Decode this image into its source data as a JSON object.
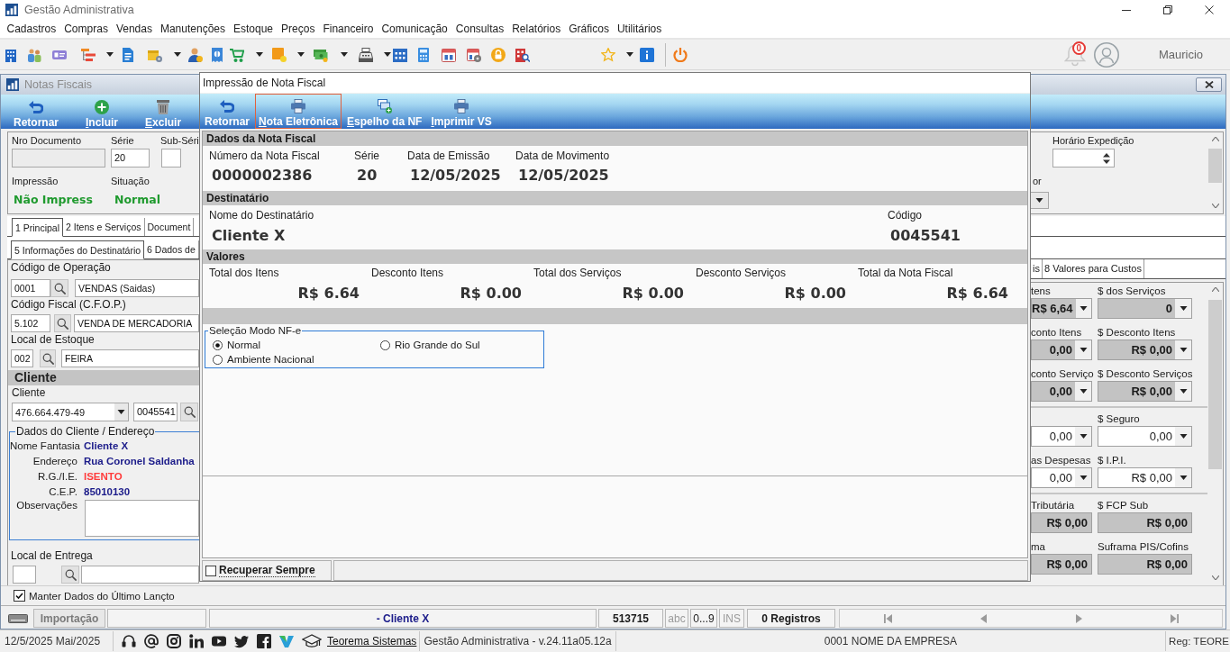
{
  "window": {
    "title": "Gestão Administrativa"
  },
  "menu": [
    "Cadastros",
    "Compras",
    "Vendas",
    "Manutenções",
    "Estoque",
    "Preços",
    "Financeiro",
    "Comunicação",
    "Consultas",
    "Relatórios",
    "Gráficos",
    "Utilitários"
  ],
  "user": {
    "notifications": "0",
    "name": "Mauricio"
  },
  "notas_fiscais": {
    "title": "Notas Fiscais",
    "toolbar": [
      {
        "label": "Retornar",
        "mnemonic": false
      },
      {
        "label": "Incluir",
        "mnemonic": true
      },
      {
        "label": "Excluir",
        "mnemonic": true
      }
    ],
    "header": {
      "nro_documento": {
        "label": "Nro Documento"
      },
      "serie": {
        "label": "Série",
        "value": "20"
      },
      "sub_serie": {
        "label": "Sub-Séri"
      },
      "impressao": {
        "label": "Impressão",
        "value": "Não Impress"
      },
      "situacao": {
        "label": "Situação",
        "value": "Normal"
      },
      "horario_expedicao": {
        "label": "Horário Expedição"
      },
      "field_7": {
        "label": "or"
      }
    },
    "tabs": [
      {
        "label": "1 Principal",
        "selected": true
      },
      {
        "label": "2 Itens e Serviços",
        "selected": false
      },
      {
        "label": "Document",
        "selected": false
      }
    ],
    "subtabs": [
      {
        "label": "5 Informações do Destinatário",
        "selected": true
      },
      {
        "label": "6 Dados de",
        "selected": false
      }
    ],
    "form": {
      "codigo_operacao": {
        "label": "Código de Operação",
        "code": "0001",
        "description": "VENDAS (Saidas)"
      },
      "codigo_fiscal": {
        "label": "Código Fiscal (C.F.O.P.)",
        "code": "5.102",
        "description": "VENDA DE MERCADORIA"
      },
      "local_estoque": {
        "label": "Local de Estoque",
        "code": "002",
        "description": "FEIRA"
      },
      "cliente_section": "Cliente",
      "cliente": {
        "label": "Cliente",
        "document": "476.664.479-49",
        "code": "0045541"
      },
      "dados_cliente": {
        "title": "Dados do Cliente / Endereço",
        "rows": [
          {
            "label": "Nome Fantasia",
            "value": "Cliente X",
            "color": "#1c1c8a"
          },
          {
            "label": "Endereço",
            "value": "Rua Coronel Saldanha",
            "color": "#1c1c8a"
          },
          {
            "label": "R.G./I.E.",
            "value": "ISENTO",
            "color": "#ff3b3b"
          },
          {
            "label": "C.E.P.",
            "value": "85010130",
            "color": "#1c1c8a"
          }
        ],
        "observacoes": "Observações"
      },
      "local_entrega": {
        "label": "Local de Entrega"
      }
    },
    "value_tabs": [
      {
        "label": "is",
        "selected": false
      },
      {
        "label": "8 Valores para Custos",
        "selected": false
      }
    ],
    "values": {
      "groups": [
        {
          "rows": [
            [
              {
                "label": "tens",
                "value": "R$ 6,64",
                "kind": "locked_select"
              },
              {
                "label": "$ dos Serviços",
                "value": "0",
                "kind": "locked_select"
              }
            ],
            [
              {
                "label": "conto Itens",
                "value": "0,00",
                "kind": "locked_select"
              },
              {
                "label": "$ Desconto Itens",
                "value": "R$ 0,00",
                "kind": "locked_select"
              }
            ],
            [
              {
                "label": "conto Serviço",
                "value": "0,00",
                "kind": "locked_select"
              },
              {
                "label": "$ Desconto Serviços",
                "value": "R$ 0,00",
                "kind": "locked_select"
              }
            ]
          ]
        },
        {
          "rows": [
            [
              {
                "value": "0,00",
                "kind": "select"
              },
              {
                "label": "$ Seguro",
                "value": "0,00",
                "kind": "select"
              }
            ],
            [
              {
                "label": "as Despesas",
                "value": "0,00",
                "kind": "select"
              },
              {
                "label": "$ I.P.I.",
                "value": "R$ 0,00",
                "kind": "select"
              }
            ]
          ]
        },
        {
          "rows": [
            [
              {
                "label": "Tributária",
                "value": "R$ 0,00",
                "kind": "locked"
              },
              {
                "label": "$ FCP Sub",
                "value": "R$ 0,00",
                "kind": "locked"
              }
            ],
            [
              {
                "label": "ma",
                "value": "R$ 0,00",
                "kind": "locked"
              },
              {
                "label": "Suframa PIS/Cofins",
                "value": "R$ 0,00",
                "kind": "locked"
              }
            ]
          ]
        }
      ]
    },
    "manter_dados": {
      "label": "Manter Dados do Último Lançto",
      "checked": true
    }
  },
  "dialog": {
    "title": "Impressão de Nota Fiscal",
    "toolbar": [
      {
        "label": "Retornar",
        "mnemonic": false,
        "focused": false
      },
      {
        "label": "Nota Eletrônica",
        "mnemonic": true,
        "focused": true
      },
      {
        "label": "Espelho da NF",
        "mnemonic": true,
        "focused": false
      },
      {
        "label": "Imprimir VS",
        "mnemonic": true,
        "focused": false
      }
    ],
    "dados_nota": {
      "title": "Dados da Nota Fiscal",
      "fields": [
        {
          "label": "Número da Nota Fiscal",
          "value": "0000002386"
        },
        {
          "label": "Série",
          "value": "20"
        },
        {
          "label": "Data de Emissão",
          "value": "12/05/2025"
        },
        {
          "label": "Data de Movimento",
          "value": "12/05/2025"
        }
      ]
    },
    "destinatario": {
      "title": "Destinatário",
      "fields": [
        {
          "label": "Nome do Destinatário",
          "value": "Cliente X"
        },
        {
          "label": "Código",
          "value": "0045541"
        }
      ]
    },
    "valores": {
      "title": "Valores",
      "fields": [
        {
          "label": "Total dos Itens",
          "value": "R$ 6.64"
        },
        {
          "label": "Desconto Itens",
          "value": "R$ 0.00"
        },
        {
          "label": "Total dos Serviços",
          "value": "R$ 0.00"
        },
        {
          "label": "Desconto Serviços",
          "value": "R$ 0.00"
        },
        {
          "label": "Total da Nota Fiscal",
          "value": "R$ 6.64"
        }
      ]
    },
    "modo_nfe": {
      "title": "Seleção Modo NF-e",
      "options": [
        {
          "label": "Normal",
          "selected": true
        },
        {
          "label": "Rio Grande do Sul",
          "selected": false
        },
        {
          "label": "Ambiente Nacional",
          "selected": false
        }
      ]
    },
    "recuperar_sempre": {
      "label": "Recuperar Sempre",
      "checked": false
    }
  },
  "status_bar": {
    "mode": "Importação",
    "record": "- Cliente X",
    "code": "513715",
    "indicators": [
      {
        "label": "abc",
        "on": false
      },
      {
        "label": "0...9",
        "on": true
      },
      {
        "label": "INS",
        "on": false
      }
    ],
    "count": "0 Registros"
  },
  "footer": {
    "date": "12/5/2025 Mai/2025",
    "link": "Teorema Sistemas",
    "version": "Gestão Administrativa - v.24.11a05.12a",
    "company": "0001 NOME DA EMPRESA",
    "registration": "Reg: TEORE"
  }
}
